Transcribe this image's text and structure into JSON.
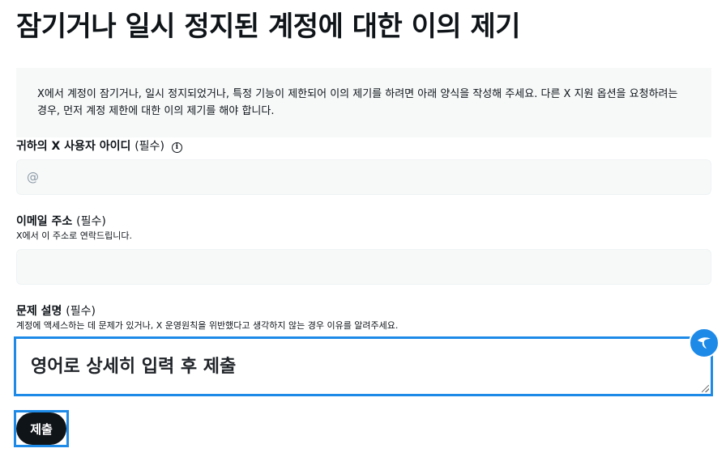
{
  "page": {
    "title": "잠기거나 일시 정지된 계정에 대한 이의 제기",
    "intro": "X에서 계정이 잠기거나, 일시 정지되었거나, 특정 기능이 제한되어 이의 제기를 하려면 아래 양식을 작성해 주세요. 다른 X 지원 옵션을 요청하려는 경우, 먼저 계정 제한에 대한 이의 제기를 해야 합니다."
  },
  "form": {
    "username": {
      "label": "귀하의 X 사용자 아이디",
      "required": "(필수)",
      "placeholder": "@",
      "value": ""
    },
    "email": {
      "label": "이메일 주소",
      "required": "(필수)",
      "hint": "X에서 이 주소로 연락드립니다.",
      "value": ""
    },
    "description": {
      "label": "문제 설명",
      "required": "(필수)",
      "hint": "계정에 액세스하는 데 문제가 있거나, X 운영원칙을 위반했다고 생각하지 않는 경우 이유를 알려주세요.",
      "value": "영어로 상세히 입력 후 제출"
    },
    "submit_label": "제출"
  },
  "icons": {
    "info": "info-icon",
    "assist": "assistant-badge-icon"
  },
  "colors": {
    "focus": "#1d8ae8",
    "button": "#0f1419",
    "field_bg": "#f7f9f9"
  }
}
